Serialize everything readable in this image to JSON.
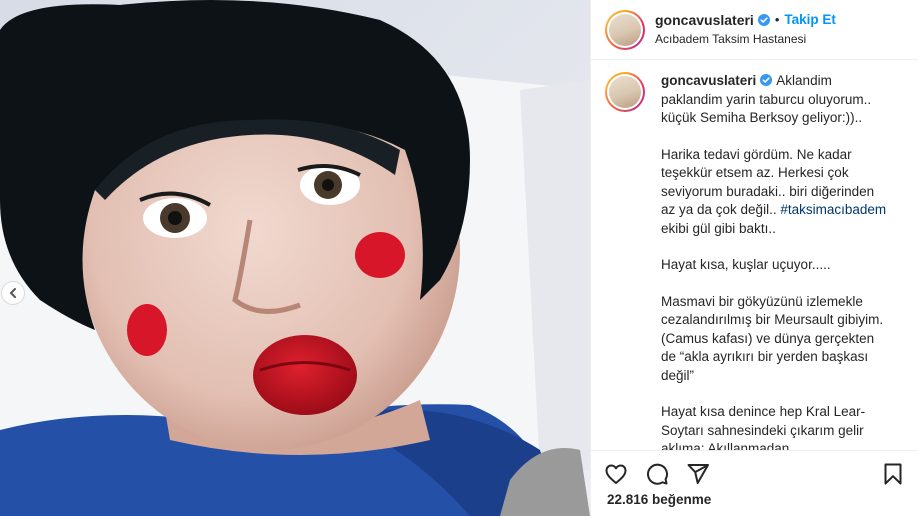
{
  "post": {
    "author": {
      "username": "goncavuslateri",
      "verified": true
    },
    "follow_label": "Takip Et",
    "separator": "•",
    "location": "Acıbadem Taksim Hastanesi",
    "caption": {
      "p1": "Aklandim paklandim yarin taburcu oluyorum.. küçük Semiha Berksoy geliyor:))..",
      "p2_before": "Harika tedavi gördüm. Ne kadar teşekkür etsem az. Herkesi çok seviyorum buradaki.. biri diğerinden az ya da çok değil.. ",
      "hashtag": "#taksimacıbadem",
      "p2_after": " ekibi gül gibi baktı..",
      "p3": "Hayat kısa, kuşlar uçuyor.....",
      "p4": "Masmavi bir gökyüzünü izlemekle cezalandırılmış bir Meursault gibiyim. (Camus kafası) ve dünya gerçekten de “akla ayrıkırı bir yerden başkası değil”",
      "p5": "Hayat kısa denince hep Kral Lear-Soytarı sahnesindeki çıkarım gelir aklıma: Akıllanmadan"
    },
    "likes_text": "22.816 beğenme",
    "icons": {
      "like": "heart-icon",
      "comment": "comment-icon",
      "share": "share-icon",
      "save": "bookmark-icon",
      "previous": "chevron-left-icon",
      "verified": "verified-badge-icon"
    },
    "colors": {
      "follow": "#0095f6",
      "verified": "#3897f0",
      "hashtag": "#00376b"
    }
  }
}
